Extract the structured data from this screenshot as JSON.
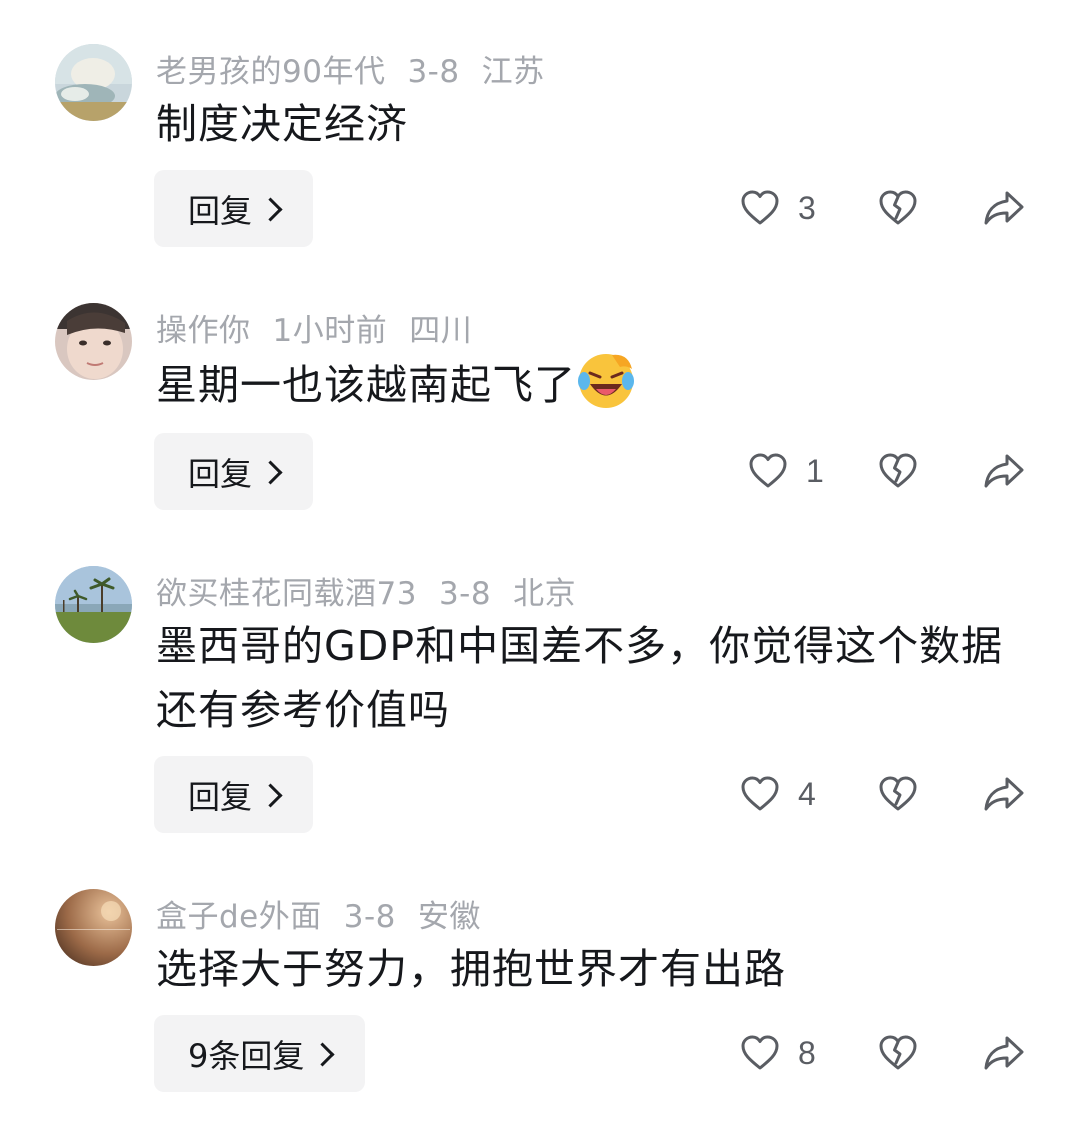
{
  "comments": [
    {
      "username": "老男孩的90年代",
      "date": "3-8",
      "location": "江苏",
      "text": "制度决定经济",
      "reply_label": "回复",
      "likes": "3"
    },
    {
      "username": "操作你",
      "date": "1小时前",
      "location": "四川",
      "text": "星期一也该越南起飞了",
      "emoji": "laughing-face-emoji",
      "reply_label": "回复",
      "likes": "1"
    },
    {
      "username": "欲买桂花同载酒73",
      "date": "3-8",
      "location": "北京",
      "text": "墨西哥的GDP和中国差不多，你觉得这个数据还有参考价值吗",
      "reply_label": "回复",
      "likes": "4"
    },
    {
      "username": "盒子de外面",
      "date": "3-8",
      "location": "安徽",
      "text": "选择大于努力，拥抱世界才有出路",
      "reply_label": "9条回复",
      "likes": "8"
    }
  ],
  "icons": {
    "like": "heart-outline-icon",
    "dislike": "broken-heart-icon",
    "share": "share-arrow-icon",
    "reply_chevron": "chevron-right-icon"
  },
  "colors": {
    "meta_text": "#a4a7ad",
    "body_text": "#16181c",
    "reply_bg": "#f3f3f4",
    "icon": "#5a5d63"
  }
}
